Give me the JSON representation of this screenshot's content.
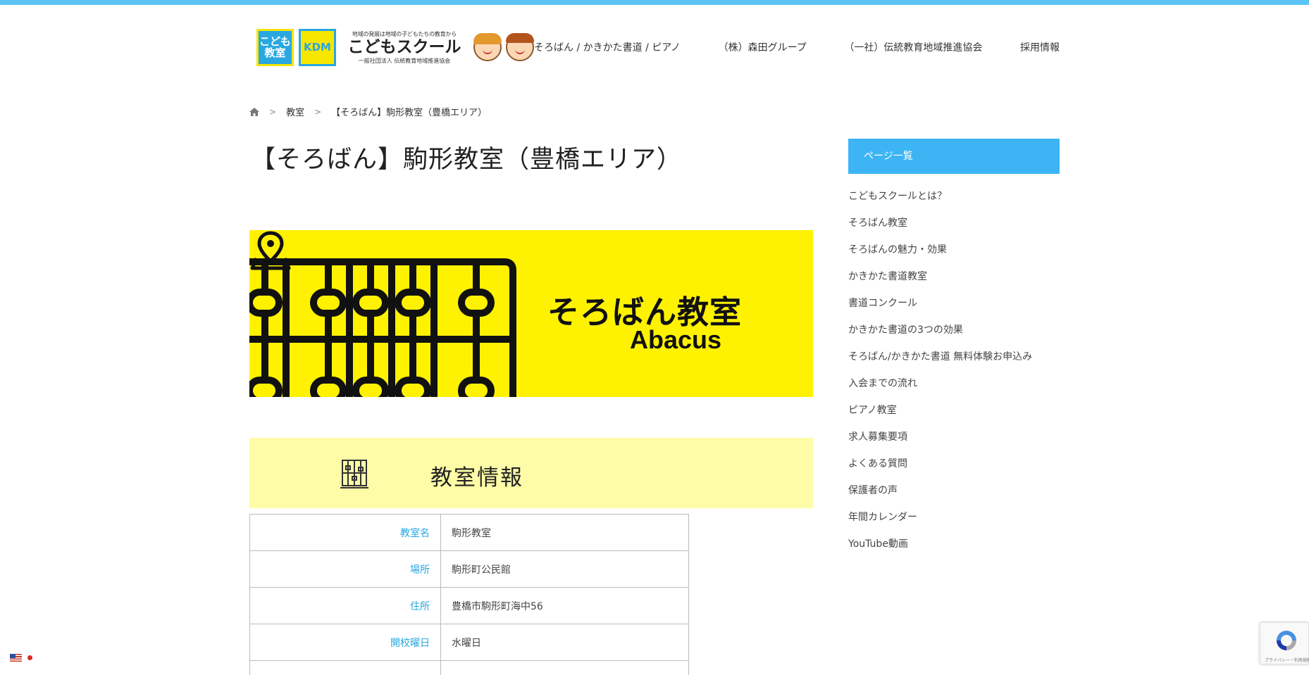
{
  "header": {
    "logo": {
      "box1_text": "こども教室",
      "box2_text": "KDM",
      "tagline": "地域の発展は地域の子どもたちの教育から",
      "name": "こどもスクール",
      "subtitle": "一般社団法人 伝統教育地域推進協会"
    },
    "nav": [
      {
        "label": "そろばん / かきかた書道 / ピアノ"
      },
      {
        "label": "（株）森田グループ"
      },
      {
        "label": "（一社）伝統教育地域推進協会"
      },
      {
        "label": "採用情報"
      }
    ]
  },
  "breadcrumb": {
    "home_icon": "home-icon",
    "items": [
      "教室",
      "【そろばん】駒形教室（豊橋エリア）"
    ]
  },
  "page": {
    "title": "【そろばん】駒形教室（豊橋エリア）",
    "banner": {
      "title": "そろばん教室",
      "subtitle": "Abacus",
      "background": "#fff200"
    },
    "info_heading": "教室情報",
    "info_table": [
      {
        "key": "教室名",
        "value": "駒形教室"
      },
      {
        "key": "場所",
        "value": "駒形町公民館"
      },
      {
        "key": "住所",
        "value": "豊橋市駒形町海中56"
      },
      {
        "key": "開校曜日",
        "value": "水曜日"
      },
      {
        "key": "",
        "value": ""
      }
    ]
  },
  "sidebar": {
    "heading": "ページ一覧",
    "items": [
      "こどもスクールとは？",
      "そろばん教室",
      "そろばんの魅力・効果",
      "かきかた書道教室",
      "書道コンクール",
      "かきかた書道の3つの効果",
      "そろばん/かきかた書道 無料体験お申込み",
      "入会までの流れ",
      "ピアノ教室",
      "求人募集要項",
      "よくある質問",
      "保護者の声",
      "年間カレンダー",
      "YouTube動画"
    ]
  },
  "widgets": {
    "recaptcha_text": "プライバシー・利用規約"
  },
  "colors": {
    "accent": "#3db5f5",
    "top_bar": "#5bc4f5",
    "banner_yellow": "#fff200",
    "info_yellow": "#fefca7",
    "table_key": "#29a7e1"
  }
}
